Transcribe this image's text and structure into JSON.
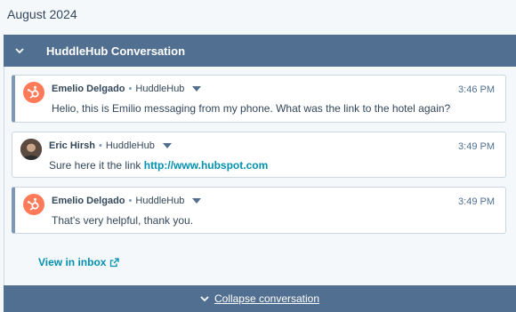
{
  "date_header": "August 2024",
  "panel": {
    "title": "HuddleHub Conversation",
    "collapse_label": "Collapse conversation",
    "view_inbox_label": "View in inbox"
  },
  "messages": [
    {
      "sender": "Emelio Delgado",
      "org": "HuddleHub",
      "time": "3:46 PM",
      "text": "Helio, this is Emilio messaging from my phone. What was the link to the hotel again?"
    },
    {
      "sender": "Eric Hirsh",
      "org": "HuddleHub",
      "time": "3:49 PM",
      "text": "Sure here it the link",
      "link": "http://www.hubspot.com"
    },
    {
      "sender": "Emelio Delgado",
      "org": "HuddleHub",
      "time": "3:49 PM",
      "text": "That's very helpful, thank you."
    }
  ],
  "separator": "•",
  "colors": {
    "header_bg": "#516f90",
    "accent_link": "#0091ae",
    "hub_orange": "#ff7a59"
  },
  "icons": [
    "chevron-down-icon",
    "hubspot-sprocket-icon",
    "caret-down-icon",
    "external-link-icon"
  ]
}
